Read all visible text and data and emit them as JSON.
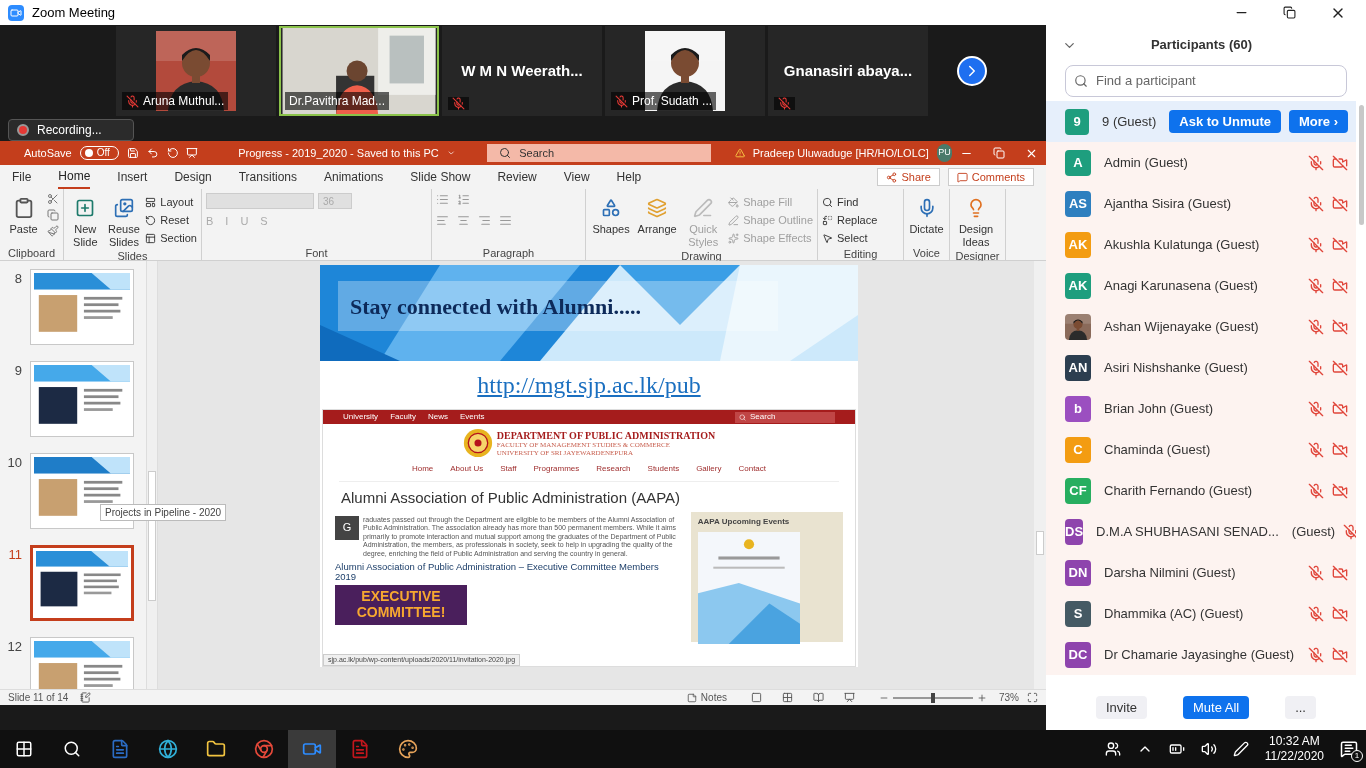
{
  "window": {
    "title": "Zoom Meeting"
  },
  "video_strip": {
    "tiles": [
      {
        "name": "Aruna Muthul...",
        "mic_muted": true,
        "selected": false
      },
      {
        "name": "Dr.Pavithra Mad...",
        "kind": "video",
        "mic_muted": false,
        "selected": true
      },
      {
        "name": "W M N Weerath...",
        "kind": "name",
        "mic_muted": true,
        "selected": false
      },
      {
        "name": "Prof. Sudath ...",
        "mic_muted": true,
        "selected": false
      },
      {
        "name": "Gnanasiri  abaya...",
        "kind": "name",
        "mic_muted": true,
        "selected": false
      }
    ]
  },
  "recording": "Recording...",
  "powerpoint": {
    "title_bar": {
      "autosave": "AutoSave",
      "autosave_state": "Off",
      "autosave_on": false,
      "document": "Progress - 2019_2020  -  Saved to this PC",
      "search_placeholder": "Search",
      "user": "Pradeep Uluwaduge [HR/HO/LOLC]",
      "initials": "PU"
    },
    "tabs": [
      {
        "label": "File",
        "selected": false
      },
      {
        "label": "Home",
        "selected": true
      },
      {
        "label": "Insert",
        "selected": false
      },
      {
        "label": "Design",
        "selected": false
      },
      {
        "label": "Transitions",
        "selected": false
      },
      {
        "label": "Animations",
        "selected": false
      },
      {
        "label": "Slide Show",
        "selected": false
      },
      {
        "label": "Review",
        "selected": false
      },
      {
        "label": "View",
        "selected": false
      },
      {
        "label": "Help",
        "selected": false
      }
    ],
    "share": "Share",
    "comments": "Comments",
    "ribbon": {
      "clipboard": {
        "label": "Clipboard",
        "paste": "Paste"
      },
      "slides": {
        "label": "Slides",
        "large": [
          "New Slide",
          "Reuse Slides"
        ],
        "small": [
          "Layout",
          "Reset",
          "Section"
        ]
      },
      "font": {
        "label": "Font",
        "size": "36",
        "styles": [
          "B",
          "I",
          "U",
          "S"
        ]
      },
      "paragraph": {
        "label": "Paragraph"
      },
      "drawing": {
        "label": "Drawing",
        "large": [
          {
            "label": "Shapes",
            "disabled": false
          },
          {
            "label": "Arrange",
            "disabled": false
          },
          {
            "label": "Quick Styles",
            "disabled": true
          }
        ],
        "small": [
          "Shape Fill",
          "Shape Outline",
          "Shape Effects"
        ]
      },
      "editing": {
        "label": "Editing",
        "items": [
          "Find",
          "Replace",
          "Select"
        ]
      },
      "voice": {
        "label": "Voice",
        "item": "Dictate"
      },
      "designer": {
        "label": "Designer",
        "item": "Design Ideas"
      }
    },
    "thumbnails": [
      {
        "number": "8",
        "selected": false
      },
      {
        "number": "9",
        "selected": false
      },
      {
        "number": "10",
        "selected": false
      },
      {
        "number": "11",
        "selected": true
      },
      {
        "number": "12",
        "selected": false
      }
    ],
    "tooltip": "Projects in Pipeline - 2020",
    "slide": {
      "title": "Stay connected with Alumni.....",
      "link": "http://mgt.sjp.ac.lk/pub",
      "website": {
        "top_links": [
          "University",
          "Faculty",
          "News",
          "Events"
        ],
        "search": "Search",
        "department": "DEPARTMENT OF PUBLIC ADMINISTRATION",
        "faculty": "FACULTY OF MANAGEMENT STUDIES & COMMERCE",
        "university": "UNIVERSITY OF SRI JAYEWARDENEPURA",
        "menu": [
          "Home",
          "About Us",
          "Staff",
          "Programmes",
          "Research",
          "Students",
          "Gallery",
          "Contact"
        ],
        "heading": "Alumni Association of Public Administration (AAPA)",
        "drop_cap": "G",
        "paragraph": "raduates passed out through the Department are eligible to be members of the Alumni Association of Public Administration. The association already has more than 500 permanent members. While it aims primarily to promote interaction and mutual support among the graduates of the Department of Public Administration, the members, as professionals in society, seek to help in upgrading the quality of the degree, enriching the field of Public Administration and serving the country in general.",
        "subheading": "Alumni Association of Public Administration – Executive Committee Members 2019",
        "banner": [
          "EXECUTIVE",
          "COMMITTEE!"
        ],
        "sidebar_title": "AAPA Upcoming Events",
        "status_url": "sjp.ac.lk/pub/wp-content/uploads/2020/11/invitation-2020.jpg"
      }
    },
    "status_bar": {
      "slide": "Slide 11 of 14",
      "notes": "Notes",
      "zoom": "73%",
      "level": 0.5
    }
  },
  "participants": {
    "title": "Participants (60)",
    "search_placeholder": "Find a participant",
    "ask_to_unmute": "Ask to Unmute",
    "more": "More ›",
    "items": [
      {
        "initials": "9",
        "color": "#1e9e7e",
        "name": "9 (Guest)",
        "kind": "initials",
        "selected": true
      },
      {
        "initials": "A",
        "color": "#1e9e7e",
        "name": "Admin (Guest)",
        "kind": "initials",
        "selected": false,
        "mic_muted": true,
        "video_off": true
      },
      {
        "initials": "AS",
        "color": "#2e7fbf",
        "name": "Ajantha Sisira (Guest)",
        "kind": "initials",
        "selected": false,
        "mic_muted": true,
        "video_off": true
      },
      {
        "initials": "AK",
        "color": "#f39c12",
        "name": "Akushla Kulatunga (Guest)",
        "kind": "initials",
        "selected": false,
        "mic_muted": true,
        "video_off": true
      },
      {
        "initials": "AK",
        "color": "#1e9e7e",
        "name": "Anagi Karunasena (Guest)",
        "kind": "initials",
        "selected": false,
        "mic_muted": true,
        "video_off": true
      },
      {
        "name": "Ashan Wijenayake (Guest)",
        "selected": false,
        "mic_muted": true,
        "video_off": true
      },
      {
        "initials": "AN",
        "color": "#2c3e50",
        "name": "Asiri Nishshanke (Guest)",
        "kind": "initials",
        "selected": false,
        "mic_muted": true,
        "video_off": true
      },
      {
        "initials": "b",
        "color": "#9b4fc0",
        "name": "Brian John (Guest)",
        "kind": "initials",
        "selected": false,
        "mic_muted": true,
        "video_off": true
      },
      {
        "initials": "C",
        "color": "#f39c12",
        "name": "Chaminda (Guest)",
        "kind": "initials",
        "selected": false,
        "mic_muted": true,
        "video_off": true
      },
      {
        "initials": "CF",
        "color": "#27ae60",
        "name": "Charith Fernando (Guest)",
        "kind": "initials",
        "selected": false,
        "mic_muted": true,
        "video_off": true
      },
      {
        "initials": "DS",
        "color": "#8e44ad",
        "name": "D.M.A SHUBHASANI SENAD...",
        "tag": "(Guest)",
        "kind": "initials",
        "selected": false,
        "mic_muted": true
      },
      {
        "initials": "DN",
        "color": "#8e44ad",
        "name": "Darsha Nilmini (Guest)",
        "kind": "initials",
        "selected": false,
        "mic_muted": true,
        "video_off": true
      },
      {
        "initials": "S",
        "color": "#455a64",
        "name": "Dhammika (AC) (Guest)",
        "kind": "initials",
        "selected": false,
        "mic_muted": true,
        "video_off": true
      },
      {
        "initials": "DC",
        "color": "#8e44ad",
        "name": "Dr Chamarie Jayasinghe (Guest)",
        "kind": "initials",
        "selected": false,
        "mic_muted": true,
        "video_off": true
      }
    ],
    "footer": [
      "Invite",
      "Mute All",
      "..."
    ]
  },
  "taskbar": {
    "time": "10:32 AM",
    "date": "11/22/2020",
    "notifications": "1"
  }
}
